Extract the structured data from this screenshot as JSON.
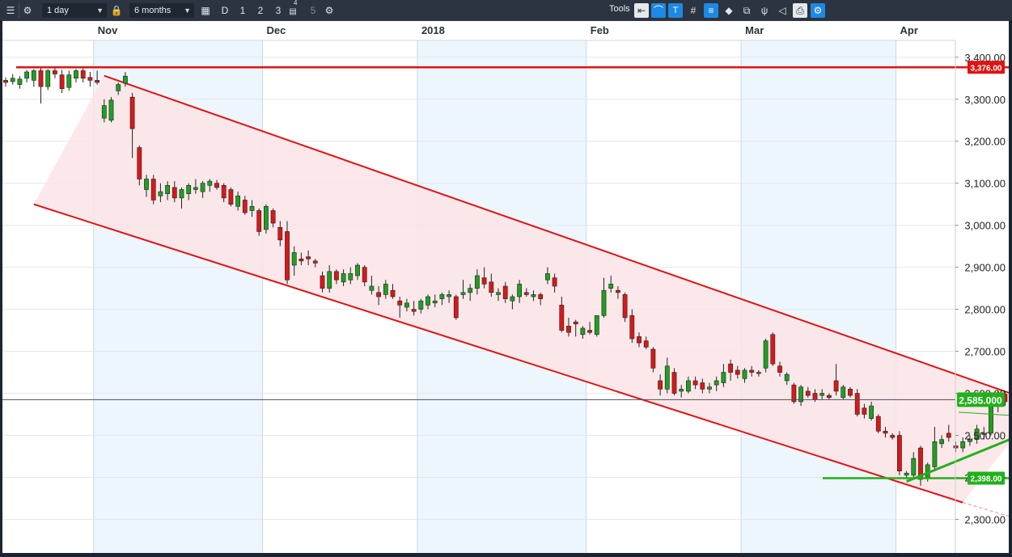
{
  "toolbar": {
    "interval": "1 day",
    "period": "6 months",
    "draw_d": "D",
    "draw_1": "1",
    "draw_2": "2",
    "draw_3": "3",
    "draw_4": "4",
    "draw_5": "5",
    "tools_label": "Tools"
  },
  "colors": {
    "up": "#1fa01f",
    "down": "#d81818",
    "resistance": "#e01212",
    "support": "#22b01b",
    "channel_fill": "#fbe4e6",
    "shade": "#eef6fd"
  },
  "chart_data": {
    "type": "candlestick",
    "title": "",
    "xlabel": "",
    "ylabel": "",
    "ylim": [
      2220,
      3440
    ],
    "grid": true,
    "month_labels": [
      "Nov",
      "Dec",
      "2018",
      "Feb",
      "Mar",
      "Apr"
    ],
    "y_ticks": [
      "2,300.00",
      "2,400.00",
      "2,500.00",
      "2,600.00",
      "2,700.00",
      "2,800.00",
      "2,900.00",
      "3,000.00",
      "3,100.00",
      "3,200.00",
      "3,300.00",
      "3,400.00"
    ],
    "candles": [
      [
        3345,
        3352,
        3330,
        3340
      ],
      [
        3342,
        3360,
        3335,
        3350
      ],
      [
        3335,
        3355,
        3325,
        3348
      ],
      [
        3350,
        3370,
        3340,
        3365
      ],
      [
        3345,
        3372,
        3330,
        3368
      ],
      [
        3368,
        3375,
        3290,
        3330
      ],
      [
        3330,
        3372,
        3322,
        3368
      ],
      [
        3368,
        3378,
        3350,
        3360
      ],
      [
        3358,
        3370,
        3315,
        3325
      ],
      [
        3328,
        3368,
        3320,
        3358
      ],
      [
        3350,
        3372,
        3340,
        3368
      ],
      [
        3368,
        3374,
        3340,
        3350
      ],
      [
        3352,
        3365,
        3330,
        3345
      ],
      [
        3345,
        3368,
        3335,
        3340
      ],
      [
        3255,
        3300,
        3245,
        3285
      ],
      [
        3250,
        3305,
        3245,
        3298
      ],
      [
        3320,
        3340,
        3310,
        3335
      ],
      [
        3338,
        3365,
        3330,
        3355
      ],
      [
        3305,
        3315,
        3160,
        3230
      ],
      [
        3185,
        3190,
        3095,
        3110
      ],
      [
        3085,
        3120,
        3068,
        3110
      ],
      [
        3110,
        3120,
        3050,
        3060
      ],
      [
        3070,
        3100,
        3055,
        3080
      ],
      [
        3075,
        3105,
        3060,
        3095
      ],
      [
        3090,
        3105,
        3055,
        3065
      ],
      [
        3065,
        3090,
        3040,
        3085
      ],
      [
        3075,
        3100,
        3060,
        3095
      ],
      [
        3085,
        3110,
        3075,
        3090
      ],
      [
        3080,
        3105,
        3065,
        3100
      ],
      [
        3095,
        3110,
        3080,
        3105
      ],
      [
        3100,
        3108,
        3085,
        3090
      ],
      [
        3095,
        3100,
        3055,
        3065
      ],
      [
        3085,
        3090,
        3045,
        3050
      ],
      [
        3045,
        3080,
        3035,
        3070
      ],
      [
        3060,
        3070,
        3025,
        3030
      ],
      [
        3035,
        3060,
        3020,
        3045
      ],
      [
        3035,
        3040,
        2975,
        2985
      ],
      [
        2990,
        3050,
        2980,
        3045
      ],
      [
        3035,
        3040,
        2995,
        3005
      ],
      [
        2995,
        3010,
        2950,
        2965
      ],
      [
        2985,
        3010,
        2860,
        2870
      ],
      [
        2905,
        2950,
        2880,
        2935
      ],
      [
        2920,
        2935,
        2905,
        2915
      ],
      [
        2925,
        2940,
        2905,
        2920
      ],
      [
        2915,
        2920,
        2900,
        2910
      ],
      [
        2880,
        2890,
        2840,
        2850
      ],
      [
        2850,
        2905,
        2840,
        2890
      ],
      [
        2890,
        2895,
        2860,
        2870
      ],
      [
        2865,
        2895,
        2855,
        2885
      ],
      [
        2870,
        2900,
        2860,
        2885
      ],
      [
        2880,
        2910,
        2870,
        2905
      ],
      [
        2900,
        2905,
        2855,
        2865
      ],
      [
        2845,
        2880,
        2835,
        2855
      ],
      [
        2840,
        2855,
        2810,
        2830
      ],
      [
        2835,
        2870,
        2825,
        2860
      ],
      [
        2845,
        2860,
        2825,
        2830
      ],
      [
        2820,
        2830,
        2780,
        2810
      ],
      [
        2805,
        2825,
        2795,
        2815
      ],
      [
        2800,
        2820,
        2785,
        2795
      ],
      [
        2800,
        2825,
        2790,
        2820
      ],
      [
        2810,
        2835,
        2800,
        2830
      ],
      [
        2815,
        2835,
        2805,
        2820
      ],
      [
        2825,
        2840,
        2810,
        2835
      ],
      [
        2830,
        2845,
        2815,
        2835
      ],
      [
        2830,
        2835,
        2775,
        2780
      ],
      [
        2835,
        2870,
        2825,
        2840
      ],
      [
        2840,
        2860,
        2820,
        2850
      ],
      [
        2850,
        2895,
        2835,
        2880
      ],
      [
        2875,
        2900,
        2850,
        2860
      ],
      [
        2865,
        2885,
        2830,
        2840
      ],
      [
        2835,
        2850,
        2820,
        2840
      ],
      [
        2855,
        2865,
        2815,
        2825
      ],
      [
        2820,
        2835,
        2800,
        2830
      ],
      [
        2830,
        2870,
        2815,
        2860
      ],
      [
        2840,
        2850,
        2830,
        2835
      ],
      [
        2830,
        2845,
        2820,
        2835
      ],
      [
        2835,
        2840,
        2810,
        2825
      ],
      [
        2870,
        2900,
        2860,
        2885
      ],
      [
        2875,
        2885,
        2840,
        2855
      ],
      [
        2810,
        2830,
        2745,
        2750
      ],
      [
        2760,
        2780,
        2735,
        2745
      ],
      [
        2770,
        2775,
        2735,
        2765
      ],
      [
        2740,
        2760,
        2730,
        2755
      ],
      [
        2750,
        2770,
        2740,
        2745
      ],
      [
        2740,
        2785,
        2735,
        2785
      ],
      [
        2785,
        2875,
        2780,
        2845
      ],
      [
        2850,
        2880,
        2840,
        2860
      ],
      [
        2845,
        2855,
        2825,
        2840
      ],
      [
        2835,
        2840,
        2770,
        2780
      ],
      [
        2785,
        2800,
        2720,
        2730
      ],
      [
        2735,
        2745,
        2710,
        2720
      ],
      [
        2725,
        2735,
        2705,
        2710
      ],
      [
        2705,
        2710,
        2650,
        2660
      ],
      [
        2630,
        2645,
        2595,
        2610
      ],
      [
        2610,
        2685,
        2600,
        2665
      ],
      [
        2650,
        2660,
        2595,
        2600
      ],
      [
        2605,
        2620,
        2590,
        2610
      ],
      [
        2605,
        2640,
        2600,
        2630
      ],
      [
        2630,
        2640,
        2610,
        2620
      ],
      [
        2625,
        2635,
        2600,
        2610
      ],
      [
        2610,
        2625,
        2600,
        2615
      ],
      [
        2620,
        2640,
        2605,
        2630
      ],
      [
        2625,
        2670,
        2615,
        2650
      ],
      [
        2670,
        2680,
        2630,
        2650
      ],
      [
        2655,
        2665,
        2635,
        2645
      ],
      [
        2635,
        2660,
        2625,
        2655
      ],
      [
        2655,
        2665,
        2640,
        2650
      ],
      [
        2650,
        2655,
        2640,
        2648
      ],
      [
        2660,
        2730,
        2650,
        2725
      ],
      [
        2740,
        2745,
        2665,
        2670
      ],
      [
        2665,
        2675,
        2640,
        2650
      ],
      [
        2630,
        2650,
        2620,
        2645
      ],
      [
        2620,
        2625,
        2575,
        2580
      ],
      [
        2580,
        2620,
        2570,
        2615
      ],
      [
        2605,
        2615,
        2590,
        2595
      ],
      [
        2600,
        2610,
        2580,
        2585
      ],
      [
        2595,
        2610,
        2585,
        2600
      ],
      [
        2595,
        2600,
        2585,
        2590
      ],
      [
        2630,
        2670,
        2595,
        2605
      ],
      [
        2590,
        2620,
        2585,
        2615
      ],
      [
        2610,
        2615,
        2590,
        2595
      ],
      [
        2600,
        2610,
        2545,
        2550
      ],
      [
        2565,
        2575,
        2540,
        2550
      ],
      [
        2540,
        2580,
        2535,
        2570
      ],
      [
        2545,
        2550,
        2505,
        2510
      ],
      [
        2510,
        2520,
        2495,
        2505
      ],
      [
        2500,
        2505,
        2490,
        2495
      ],
      [
        2500,
        2510,
        2405,
        2415
      ],
      [
        2405,
        2415,
        2395,
        2410
      ],
      [
        2405,
        2460,
        2395,
        2445
      ],
      [
        2470,
        2475,
        2380,
        2395
      ],
      [
        2400,
        2435,
        2390,
        2430
      ],
      [
        2425,
        2520,
        2420,
        2485
      ],
      [
        2480,
        2500,
        2470,
        2490
      ],
      [
        2505,
        2525,
        2485,
        2495
      ],
      [
        2475,
        2485,
        2460,
        2470
      ],
      [
        2470,
        2495,
        2460,
        2485
      ],
      [
        2485,
        2500,
        2475,
        2490
      ],
      [
        2490,
        2525,
        2480,
        2515
      ],
      [
        2505,
        2520,
        2490,
        2505
      ],
      [
        2505,
        2590,
        2500,
        2585
      ],
      [
        2580,
        2605,
        2555,
        2600
      ],
      [
        2598,
        2605,
        2570,
        2580
      ],
      [
        2575,
        2600,
        2560,
        2590
      ]
    ],
    "resistance_level": 3376,
    "resistance_label": "3,376.00",
    "support_level": 2398,
    "support_label": "2,398.00",
    "last_price": 2585,
    "last_price_label": "2,585.000",
    "channel": {
      "upper_start": [
        14,
        3356
      ],
      "upper_end": [
        147,
        2575
      ],
      "lower_start": [
        4,
        3050
      ],
      "lower_end": [
        136,
        2340
      ],
      "projection_end": [
        148,
        2280
      ]
    },
    "trend_line": {
      "start": [
        128,
        2390
      ],
      "end": [
        150,
        2540
      ]
    }
  }
}
